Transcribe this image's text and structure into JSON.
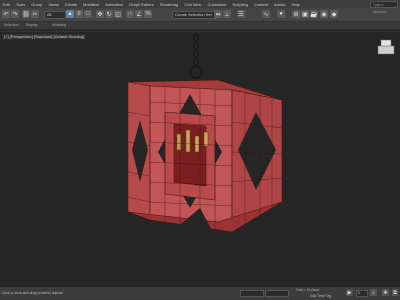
{
  "menu": [
    "Edit",
    "Tools",
    "Group",
    "Views",
    "Create",
    "Modifiers",
    "Animation",
    "Graph Editors",
    "Rendering",
    "Civil View",
    "Customize",
    "Scripting",
    "Content",
    "Arnold",
    "Help"
  ],
  "toolbar": {
    "undo_icon": "undo-icon",
    "redo_icon": "redo-icon",
    "filter_value": "All",
    "selection_set_value": "Create Selection Set"
  },
  "subbar": {
    "left_label": "Selection",
    "mid_label": "Display",
    "right_label": "Modeling"
  },
  "search": {
    "placeholder": "Type a keyword"
  },
  "viewport": {
    "label": "[+] [Perspective] [Standard] [Default Shading]"
  },
  "status": {
    "left_text": "Click or click-and-drag to select objects",
    "grid_text": "Grid = 10,0mm",
    "add_time_tag": "Add Time Tag",
    "frame_value": "0"
  },
  "colors": {
    "cage_fill": "#b84a4a",
    "cage_dark": "#8a2626",
    "wire": "#2b0b0b",
    "candle": "#c9a45a",
    "accent": "#5b7fa6"
  }
}
